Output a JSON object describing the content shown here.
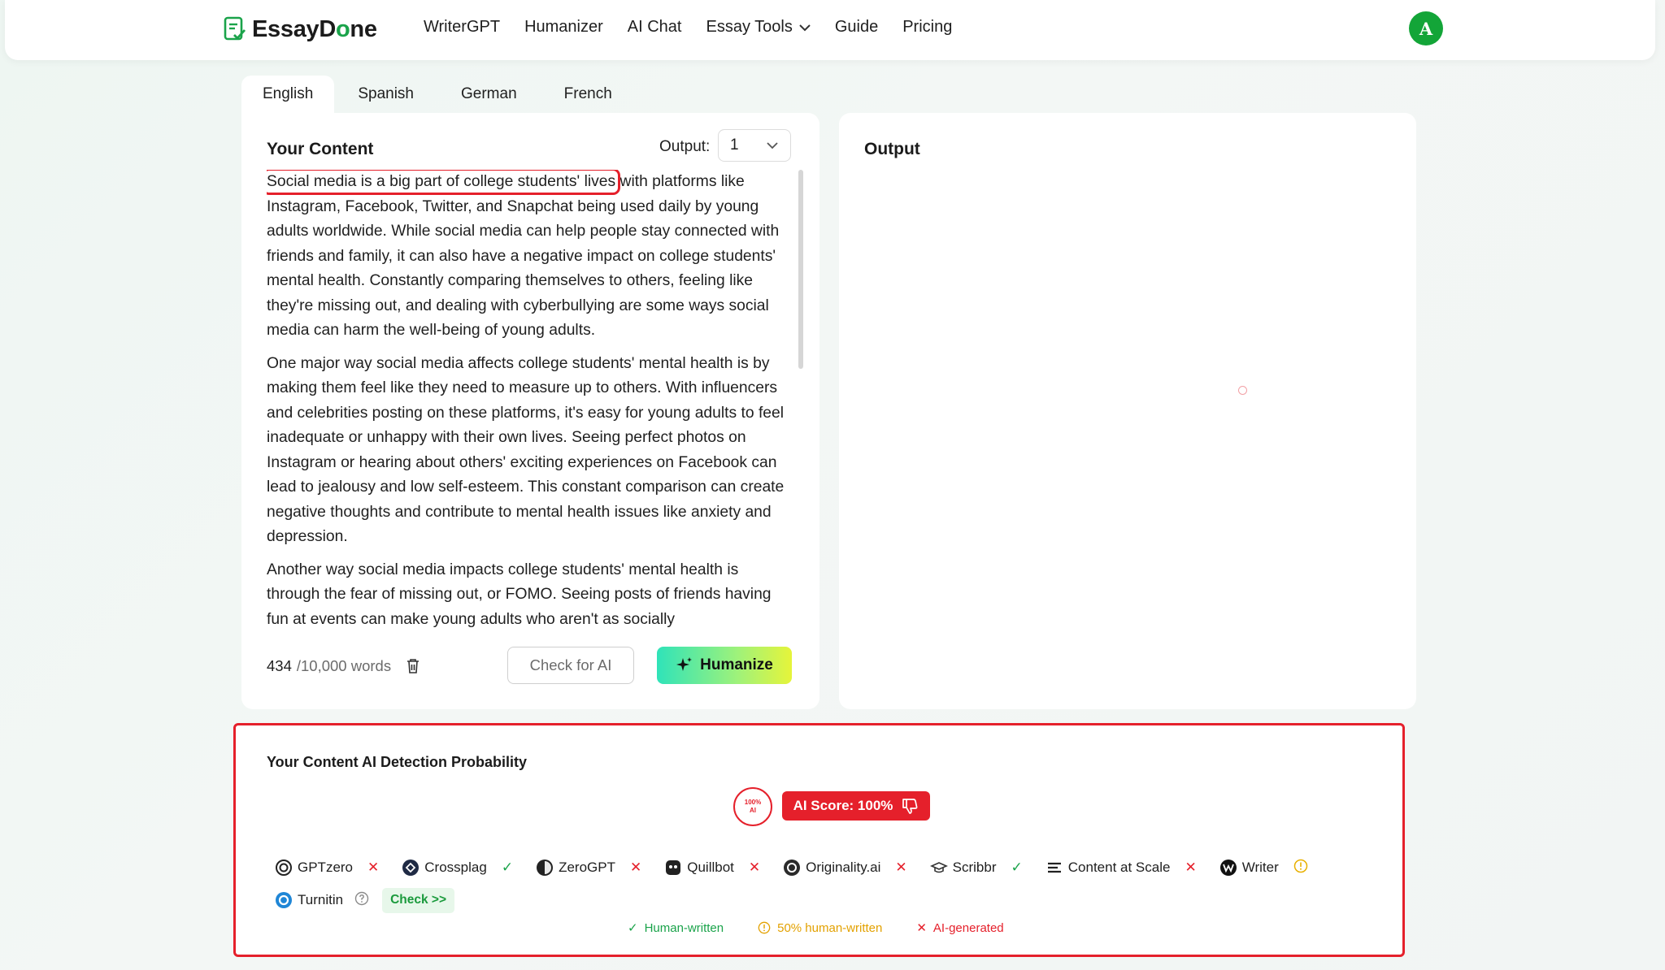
{
  "header": {
    "logo_prefix": "EssayD",
    "logo_o": "o",
    "logo_suffix": "ne",
    "nav": [
      "WriterGPT",
      "Humanizer",
      "AI Chat",
      "Essay Tools",
      "Guide",
      "Pricing"
    ],
    "avatar_letter": "A"
  },
  "languages": [
    "English",
    "Spanish",
    "German",
    "French"
  ],
  "content": {
    "title": "Your Content",
    "output_label": "Output:",
    "output_value": "1",
    "highlight": "Social media is a big part of college students' lives",
    "para1_rest": " with platforms like Instagram, Facebook, Twitter, and Snapchat being used daily by young adults worldwide. While social media can help people stay connected with friends and family, it can also have a negative impact on college students' mental health. Constantly comparing themselves to others, feeling like they're missing out, and dealing with cyberbullying are some ways social media can harm the well-being of young adults.",
    "para2": "One major way social media affects college students' mental health is by making them feel like they need to measure up to others. With influencers and celebrities posting on these platforms, it's easy for young adults to feel inadequate or unhappy with their own lives. Seeing perfect photos on Instagram or hearing about others' exciting experiences on Facebook can lead to jealousy and low self-esteem. This constant comparison can create negative thoughts and contribute to mental health issues like anxiety and depression.",
    "para3": "Another way social media impacts college students' mental health is through the fear of missing out, or FOMO. Seeing posts of friends having fun at events can make young adults who aren't as socially",
    "word_count": "434",
    "word_total": "/10,000 words",
    "check_ai_label": "Check for AI",
    "humanize_label": "Humanize"
  },
  "output": {
    "title": "Output"
  },
  "detection": {
    "title": "Your Content AI Detection Probability",
    "circle_line1": "100%",
    "circle_line2": "AI",
    "score_label": "AI Score: 100%",
    "detectors": [
      {
        "name": "GPTzero",
        "status": "ai"
      },
      {
        "name": "Crossplag",
        "status": "human"
      },
      {
        "name": "ZeroGPT",
        "status": "ai"
      },
      {
        "name": "Quillbot",
        "status": "ai"
      },
      {
        "name": "Originality.ai",
        "status": "ai"
      },
      {
        "name": "Scribbr",
        "status": "human"
      },
      {
        "name": "Content at Scale",
        "status": "ai"
      },
      {
        "name": "Writer",
        "status": "mixed"
      },
      {
        "name": "Turnitin",
        "status": "unknown"
      }
    ],
    "check_link": "Check >>",
    "legend": {
      "human": "Human-written",
      "mixed": "50% human-written",
      "ai": "AI-generated"
    }
  },
  "colors": {
    "brand_green": "#13a538",
    "alert_red": "#e5202b",
    "warn_amber": "#e8b000"
  }
}
